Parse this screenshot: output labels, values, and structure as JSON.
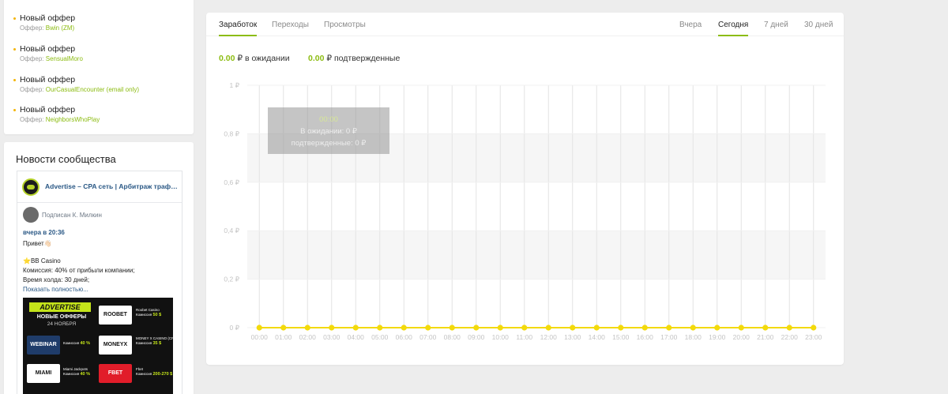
{
  "offers": [
    {
      "title": "Новый оффер",
      "label": "Оффер:",
      "name": "Bwin (ZM)"
    },
    {
      "title": "Новый оффер",
      "label": "Оффер:",
      "name": "SensualMoro"
    },
    {
      "title": "Новый оффер",
      "label": "Оффер:",
      "name": "OurCasualEncounter (email only)"
    },
    {
      "title": "Новый оффер",
      "label": "Оффер:",
      "name": "NeighborsWhoPlay"
    }
  ],
  "news": {
    "title": "Новости сообщества",
    "group_name": "Advertise – CPA сеть | Арбитраж трафика",
    "signed": "Подписан К. Милкин",
    "time": "вчера в 20:36",
    "greeting": "Привет👋🏻",
    "lines": [
      "⭐BB Casino",
      "Комиссия: 40% от прибыли компании;",
      "Время холда: 30 дней;"
    ],
    "more": "Показать полностью...",
    "banner": {
      "title": "ADVERTISE",
      "subtitle": "НОВЫЕ ОФФЕРЫ",
      "date": "24 НОЯБРЯ",
      "logos": [
        {
          "name": "ROOBET",
          "info": "Roobet Casino",
          "commission": "Комиссия",
          "value": "50 $"
        },
        {
          "name": "WEBINAR",
          "info": "",
          "commission": "Комиссия",
          "value": "40 %"
        },
        {
          "name": "MONEYX",
          "info": "MONEY X CASINO (CPA)",
          "commission": "Комиссия",
          "value": "35 $"
        },
        {
          "name": "MIAMI",
          "info": "Miami Jackpots",
          "commission": "Комиссия",
          "value": "40 %"
        },
        {
          "name": "FBET",
          "info": "Fbet",
          "commission": "Комиссия",
          "value": "200-270 $"
        }
      ]
    }
  },
  "tabs_left": [
    {
      "label": "Заработок",
      "active": true
    },
    {
      "label": "Переходы",
      "active": false
    },
    {
      "label": "Просмотры",
      "active": false
    }
  ],
  "tabs_right": [
    {
      "label": "Вчера",
      "active": false
    },
    {
      "label": "Сегодня",
      "active": true
    },
    {
      "label": "7 дней",
      "active": false
    },
    {
      "label": "30 дней",
      "active": false
    }
  ],
  "totals": {
    "pending_amount": "0.00",
    "pending_label": "₽ в ожидании",
    "confirmed_amount": "0.00",
    "confirmed_label": "₽ подтвержденные"
  },
  "tooltip": {
    "time": "00:00",
    "pending": "В ожидании: 0 ₽",
    "confirmed": "подтвержденные: 0 ₽"
  },
  "chart_data": {
    "type": "line",
    "x": [
      "00:00",
      "01:00",
      "02:00",
      "03:00",
      "04:00",
      "05:00",
      "06:00",
      "07:00",
      "08:00",
      "09:00",
      "10:00",
      "11:00",
      "12:00",
      "13:00",
      "14:00",
      "15:00",
      "16:00",
      "17:00",
      "18:00",
      "19:00",
      "20:00",
      "21:00",
      "22:00",
      "23:00"
    ],
    "series": [
      {
        "values": [
          0,
          0,
          0,
          0,
          0,
          0,
          0,
          0,
          0,
          0,
          0,
          0,
          0,
          0,
          0,
          0,
          0,
          0,
          0,
          0,
          0,
          0,
          0,
          0
        ]
      }
    ],
    "y_ticks": [
      "0 ₽",
      "0,2 ₽",
      "0,4 ₽",
      "0,6 ₽",
      "0,8 ₽",
      "1 ₽"
    ],
    "ylim": [
      0,
      1
    ],
    "grid": true,
    "line_color": "#f3da0b",
    "band_color": "#f6f6f6"
  },
  "colors": {
    "accent": "#8cbc12",
    "bullet": "#f3b400"
  }
}
